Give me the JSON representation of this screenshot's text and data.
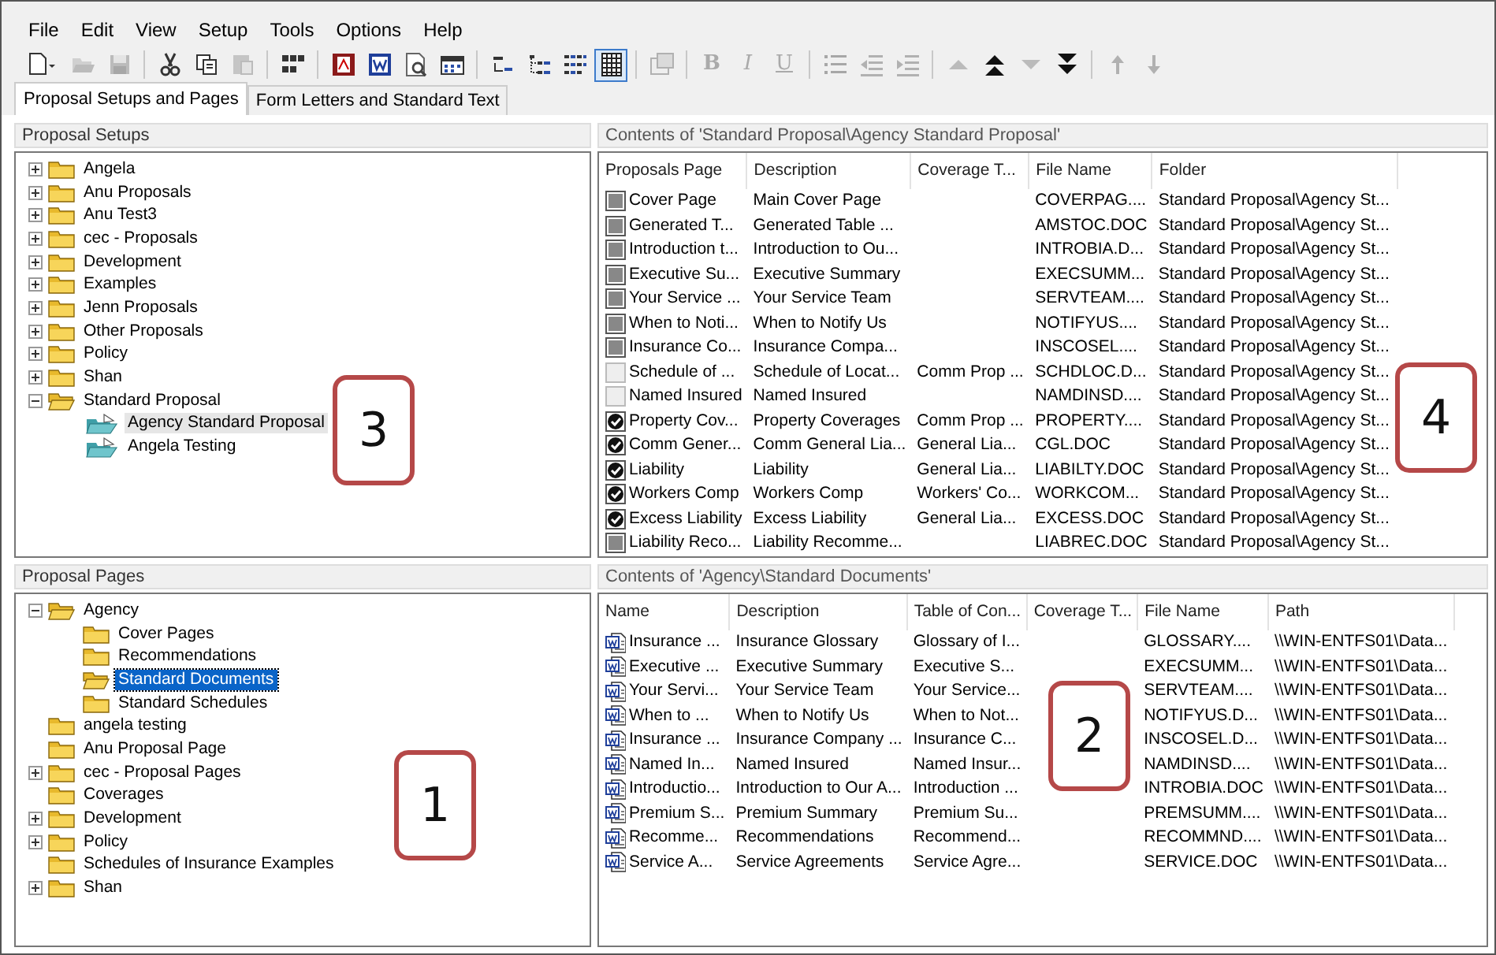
{
  "menu": [
    "File",
    "Edit",
    "View",
    "Setup",
    "Tools",
    "Options",
    "Help"
  ],
  "toolbar": [
    {
      "kind": "new",
      "selected": false,
      "disabled": false
    },
    {
      "kind": "open",
      "selected": false,
      "disabled": true
    },
    {
      "kind": "save",
      "selected": false,
      "disabled": true
    },
    {
      "kind": "separator"
    },
    {
      "kind": "cut",
      "selected": false,
      "disabled": false
    },
    {
      "kind": "copy",
      "selected": false,
      "disabled": false
    },
    {
      "kind": "paste",
      "selected": false,
      "disabled": true
    },
    {
      "kind": "separator"
    },
    {
      "kind": "grid",
      "selected": false,
      "disabled": false
    },
    {
      "kind": "separator"
    },
    {
      "kind": "pdf",
      "selected": false,
      "disabled": false
    },
    {
      "kind": "word",
      "selected": false,
      "disabled": false
    },
    {
      "kind": "preview",
      "selected": false,
      "disabled": false
    },
    {
      "kind": "calendar",
      "selected": false,
      "disabled": false
    },
    {
      "kind": "separator"
    },
    {
      "kind": "view_small",
      "selected": false,
      "disabled": false
    },
    {
      "kind": "view_tree",
      "selected": false,
      "disabled": false
    },
    {
      "kind": "view_list",
      "selected": false,
      "disabled": false
    },
    {
      "kind": "view_details",
      "selected": true,
      "disabled": false
    },
    {
      "kind": "separator"
    },
    {
      "kind": "properties",
      "selected": false,
      "disabled": true
    },
    {
      "kind": "separator"
    },
    {
      "kind": "bold",
      "label": "B",
      "selected": false,
      "disabled": true
    },
    {
      "kind": "italic",
      "label": "I",
      "selected": false,
      "disabled": true
    },
    {
      "kind": "underline",
      "label": "U",
      "selected": false,
      "disabled": true
    },
    {
      "kind": "separator"
    },
    {
      "kind": "bullets",
      "selected": false,
      "disabled": true
    },
    {
      "kind": "outdent",
      "selected": false,
      "disabled": true
    },
    {
      "kind": "indent",
      "selected": false,
      "disabled": true
    },
    {
      "kind": "separator"
    },
    {
      "kind": "up",
      "selected": false,
      "disabled": true
    },
    {
      "kind": "top",
      "selected": false,
      "disabled": false
    },
    {
      "kind": "down",
      "selected": false,
      "disabled": true
    },
    {
      "kind": "bottom",
      "selected": false,
      "disabled": false
    },
    {
      "kind": "separator"
    },
    {
      "kind": "arrow_up",
      "selected": false,
      "disabled": true
    },
    {
      "kind": "arrow_down",
      "selected": false,
      "disabled": true
    }
  ],
  "tabs": [
    {
      "label": "Proposal Setups and Pages",
      "selected": true
    },
    {
      "label": "Form Letters and Standard Text",
      "selected": false
    }
  ],
  "setups": {
    "title": "Proposal Setups",
    "focused": false,
    "tree": [
      {
        "label": "Angela",
        "kind": "folder",
        "expanded": false,
        "selected": false
      },
      {
        "label": "Anu Proposals",
        "kind": "folder",
        "expanded": false,
        "selected": false
      },
      {
        "label": "Anu Test3",
        "kind": "folder",
        "expanded": false,
        "selected": false
      },
      {
        "label": "cec - Proposals",
        "kind": "folder",
        "expanded": false,
        "selected": false
      },
      {
        "label": "Development",
        "kind": "folder",
        "expanded": false,
        "selected": false
      },
      {
        "label": "Examples",
        "kind": "folder",
        "expanded": false,
        "selected": false
      },
      {
        "label": "Jenn Proposals",
        "kind": "folder",
        "expanded": false,
        "selected": false
      },
      {
        "label": "Other Proposals",
        "kind": "folder",
        "expanded": false,
        "selected": false
      },
      {
        "label": "Policy",
        "kind": "folder",
        "expanded": false,
        "selected": false
      },
      {
        "label": "Shan",
        "kind": "folder",
        "expanded": false,
        "selected": false
      },
      {
        "label": "Standard Proposal",
        "kind": "open_folder",
        "expanded": true,
        "selected": false,
        "children": [
          {
            "label": "Agency Standard Proposal",
            "kind": "proposal",
            "selected": true
          },
          {
            "label": "Angela Testing",
            "kind": "proposal",
            "selected": false
          }
        ]
      }
    ]
  },
  "pages": {
    "title": "Proposal Pages",
    "focused": true,
    "tree": [
      {
        "label": "Agency",
        "kind": "open_folder",
        "expanded": true,
        "selected": false,
        "children": [
          {
            "label": "Cover Pages",
            "kind": "folder",
            "selected": false
          },
          {
            "label": "Recommendations",
            "kind": "folder",
            "selected": false
          },
          {
            "label": "Standard Documents",
            "kind": "open_folder",
            "selected": true
          },
          {
            "label": "Standard Schedules",
            "kind": "folder",
            "selected": false
          }
        ]
      },
      {
        "label": "angela testing",
        "kind": "folder",
        "selected": false
      },
      {
        "label": "Anu Proposal Page",
        "kind": "folder",
        "selected": false
      },
      {
        "label": "cec - Proposal Pages",
        "kind": "folder",
        "expanded": false,
        "selected": false
      },
      {
        "label": "Coverages",
        "kind": "folder",
        "selected": false
      },
      {
        "label": "Development",
        "kind": "folder",
        "expanded": false,
        "selected": false
      },
      {
        "label": "Policy",
        "kind": "folder",
        "expanded": false,
        "selected": false
      },
      {
        "label": "Schedules of Insurance Examples",
        "kind": "folder",
        "selected": false
      },
      {
        "label": "Shan",
        "kind": "folder",
        "expanded": false,
        "selected": false
      }
    ]
  },
  "contents": {
    "title": "Contents of 'Standard Proposal\\Agency Standard Proposal'",
    "columns": [
      "Proposals Page",
      "Description",
      "Coverage T...",
      "File Name",
      "Folder"
    ],
    "rows": [
      {
        "kind": "fixed",
        "cells": [
          "Cover Page",
          "Main Cover Page",
          "",
          "COVERPAG....",
          "Standard Proposal\\Agency St..."
        ]
      },
      {
        "kind": "fixed",
        "cells": [
          "Generated T...",
          "Generated Table ...",
          "",
          "AMSTOC.DOC",
          "Standard Proposal\\Agency St..."
        ]
      },
      {
        "kind": "fixed",
        "cells": [
          "Introduction t...",
          "Introduction to Ou...",
          "",
          "INTROBIA.D...",
          "Standard Proposal\\Agency St..."
        ]
      },
      {
        "kind": "fixed",
        "cells": [
          "Executive Su...",
          "Executive Summary",
          "",
          "EXECSUMM...",
          "Standard Proposal\\Agency St..."
        ]
      },
      {
        "kind": "fixed",
        "cells": [
          "Your Service ...",
          "Your Service Team",
          "",
          "SERVTEAM....",
          "Standard Proposal\\Agency St..."
        ]
      },
      {
        "kind": "fixed",
        "cells": [
          "When to Noti...",
          "When to Notify Us",
          "",
          "NOTIFYUS....",
          "Standard Proposal\\Agency St..."
        ]
      },
      {
        "kind": "fixed",
        "cells": [
          "Insurance Co...",
          "Insurance Compa...",
          "",
          "INSCOSEL....",
          "Standard Proposal\\Agency St..."
        ]
      },
      {
        "kind": "optional",
        "checked": false,
        "cells": [
          "Schedule of ...",
          "Schedule of Locat...",
          "Comm Prop ...",
          "SCHDLOC.D...",
          "Standard Proposal\\Agency St..."
        ]
      },
      {
        "kind": "optional",
        "checked": false,
        "cells": [
          "Named Insured",
          "Named Insured",
          "",
          "NAMDINSD....",
          "Standard Proposal\\Agency St..."
        ]
      },
      {
        "kind": "optional",
        "checked": true,
        "cells": [
          "Property Cov...",
          "Property Coverages",
          "Comm Prop ...",
          "PROPERTY....",
          "Standard Proposal\\Agency St..."
        ]
      },
      {
        "kind": "optional",
        "checked": true,
        "cells": [
          "Comm Gener...",
          "Comm General Lia...",
          "General Lia...",
          "CGL.DOC",
          "Standard Proposal\\Agency St..."
        ]
      },
      {
        "kind": "optional",
        "checked": true,
        "cells": [
          "Liability",
          "Liability",
          "General Lia...",
          "LIABILTY.DOC",
          "Standard Proposal\\Agency St..."
        ]
      },
      {
        "kind": "optional",
        "checked": true,
        "cells": [
          "Workers Comp",
          "Workers Comp",
          "Workers' Co...",
          "WORKCOM...",
          "Standard Proposal\\Agency St..."
        ]
      },
      {
        "kind": "optional",
        "checked": true,
        "cells": [
          "Excess Liability",
          "Excess Liability",
          "General Lia...",
          "EXCESS.DOC",
          "Standard Proposal\\Agency St..."
        ]
      },
      {
        "kind": "fixed",
        "cells": [
          "Liability Reco...",
          "Liability Recomme...",
          "",
          "LIABREC.DOC",
          "Standard Proposal\\Agency St..."
        ]
      }
    ]
  },
  "documents": {
    "title": "Contents of 'Agency\\Standard Documents'",
    "columns": [
      "Name",
      "Description",
      "Table of Con...",
      "Coverage T...",
      "File Name",
      "Path"
    ],
    "rows": [
      {
        "cells": [
          "Insurance ...",
          "Insurance Glossary",
          "Glossary of I...",
          "",
          "GLOSSARY....",
          "\\\\WIN-ENTFS01\\Data..."
        ]
      },
      {
        "cells": [
          "Executive ...",
          "Executive Summary",
          "Executive S...",
          "",
          "EXECSUMM...",
          "\\\\WIN-ENTFS01\\Data..."
        ]
      },
      {
        "cells": [
          "Your Servi...",
          "Your Service Team",
          "Your Service...",
          "",
          "SERVTEAM....",
          "\\\\WIN-ENTFS01\\Data..."
        ]
      },
      {
        "cells": [
          "When to ...",
          "When to Notify Us",
          "When to Not...",
          "",
          "NOTIFYUS.D...",
          "\\\\WIN-ENTFS01\\Data..."
        ]
      },
      {
        "cells": [
          "Insurance ...",
          "Insurance Company ...",
          "Insurance C...",
          "",
          "INSCOSEL.D...",
          "\\\\WIN-ENTFS01\\Data..."
        ]
      },
      {
        "cells": [
          "Named In...",
          "Named Insured",
          "Named Insur...",
          "",
          "NAMDINSD....",
          "\\\\WIN-ENTFS01\\Data..."
        ]
      },
      {
        "cells": [
          "Introductio...",
          "Introduction to Our A...",
          "Introduction ...",
          "",
          "INTROBIA.DOC",
          "\\\\WIN-ENTFS01\\Data..."
        ]
      },
      {
        "cells": [
          "Premium S...",
          "Premium Summary",
          "Premium Su...",
          "",
          "PREMSUMM....",
          "\\\\WIN-ENTFS01\\Data..."
        ]
      },
      {
        "cells": [
          "Recomme...",
          "Recommendations",
          "Recommend...",
          "",
          "RECOMMND....",
          "\\\\WIN-ENTFS01\\Data..."
        ]
      },
      {
        "cells": [
          "Service A...",
          "Service Agreements",
          "Service Agre...",
          "",
          "SERVICE.DOC",
          "\\\\WIN-ENTFS01\\Data..."
        ]
      }
    ]
  },
  "callouts": [
    {
      "label": "3"
    },
    {
      "label": "4"
    },
    {
      "label": "2"
    },
    {
      "label": "1"
    }
  ]
}
